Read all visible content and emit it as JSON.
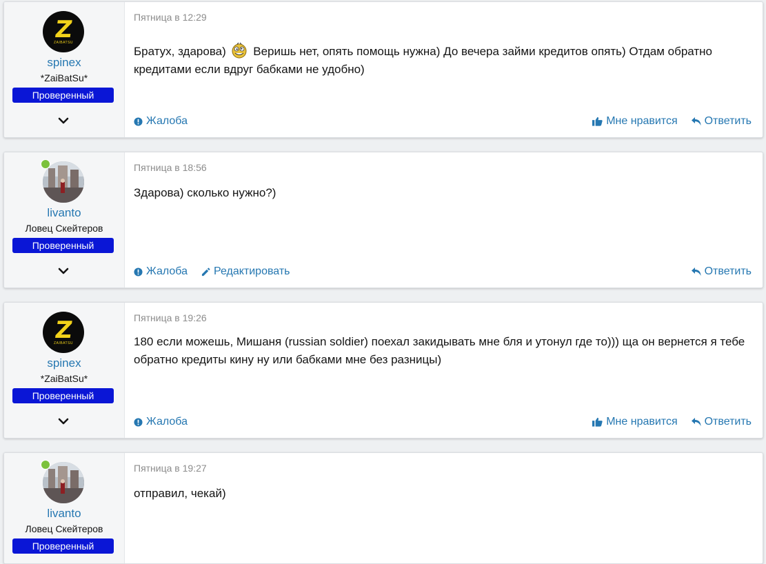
{
  "posts": [
    {
      "user": {
        "name": "spinex",
        "title": "*ZaiBatSu*",
        "badge": "Проверенный",
        "avatar": "zaibatsu-logo",
        "avatar_text": "Z",
        "avatar_sub": "ZAIBATSU",
        "online": false
      },
      "date": "Пятница в 12:29",
      "text_before": "Братух, здарова)",
      "text_after": "Веришь нет, опять помощь нужна) До вечера займи кредитов опять) Отдам обратно кредитами если вдруг бабками не удобно)",
      "actions": {
        "report": "Жалоба",
        "like": "Мне нравится",
        "reply": "Ответить"
      }
    },
    {
      "user": {
        "name": "livanto",
        "title": "Ловец Скейтеров",
        "badge": "Проверенный",
        "avatar": "photo-avatar",
        "online": true
      },
      "date": "Пятница в 18:56",
      "text": "Здарова) сколько нужно?)",
      "actions": {
        "report": "Жалоба",
        "edit": "Редактировать",
        "reply": "Ответить"
      }
    },
    {
      "user": {
        "name": "spinex",
        "title": "*ZaiBatSu*",
        "badge": "Проверенный",
        "avatar": "zaibatsu-logo",
        "avatar_text": "Z",
        "avatar_sub": "ZAIBATSU",
        "online": false
      },
      "date": "Пятница в 19:26",
      "text": "180 если можешь, Мишаня (russian soldier) поехал закидывать мне бля и утонул где то))) ща он вернется я тебе обратно кредиты кину ну или бабками мне без разницы)",
      "actions": {
        "report": "Жалоба",
        "like": "Мне нравится",
        "reply": "Ответить"
      }
    },
    {
      "user": {
        "name": "livanto",
        "title": "Ловец Скейтеров",
        "badge": "Проверенный",
        "avatar": "photo-avatar",
        "online": true
      },
      "date": "Пятница в 19:27",
      "text": "отправил, чекай)"
    }
  ],
  "colors": {
    "link": "#2577b1",
    "badge": "#0a16d6",
    "online": "#7cc13c",
    "logo": "#f2d21a"
  }
}
